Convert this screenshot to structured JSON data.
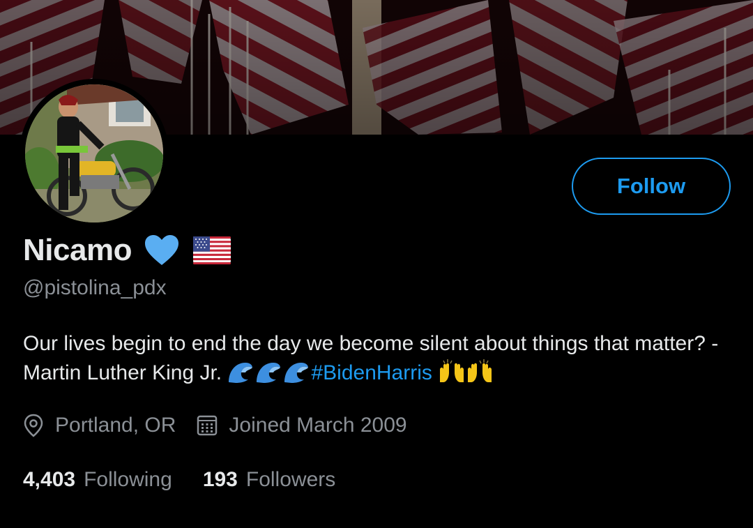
{
  "profile": {
    "display_name": "Nicamo",
    "handle": "@pistolina_pdx",
    "bio_text": "Our lives begin to end the day we become silent about things that matter? - Martin Luther King Jr. ",
    "bio_hashtag": "#BidenHarris",
    "location": "Portland, OR",
    "joined": "Joined March 2009",
    "following_count": "4,403",
    "following_label": "Following",
    "followers_count": "193",
    "followers_label": "Followers",
    "name_emojis": [
      "blue-heart-icon",
      "us-flag-icon"
    ],
    "bio_emojis": [
      "water-wave-icon",
      "water-wave-icon",
      "water-wave-icon",
      "raising-hands-icon",
      "raising-hands-icon"
    ]
  },
  "actions": {
    "follow_label": "Follow"
  },
  "icons": {
    "location": "map-pin-icon",
    "joined": "calendar-icon"
  },
  "colors": {
    "background": "#000000",
    "accent": "#1d9bf0",
    "primary_text": "#e7e9ea",
    "secondary_text": "#8b9096",
    "heart": "#5aaef2"
  }
}
